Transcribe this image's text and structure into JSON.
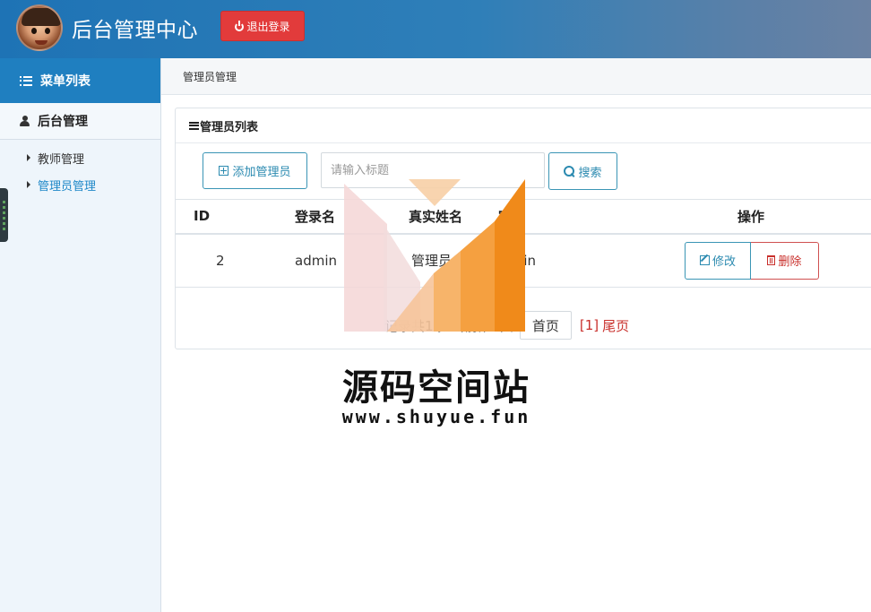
{
  "header": {
    "app_title": "后台管理中心",
    "logout_label": "退出登录",
    "colors": {
      "bar": "#1e73b5",
      "logout": "#e23b3b"
    }
  },
  "sidebar": {
    "heading": "菜单列表",
    "group_label": "后台管理",
    "items": [
      {
        "label": "教师管理",
        "active": false
      },
      {
        "label": "管理员管理",
        "active": true
      }
    ]
  },
  "main": {
    "breadcrumb": "管理员管理",
    "panel_title": "管理员列表",
    "toolbar": {
      "add_label": "添加管理员",
      "search_placeholder": "请输入标题",
      "search_label": "搜索"
    },
    "table": {
      "columns": [
        "ID",
        "登录名",
        "真实姓名",
        "密码",
        "操作"
      ],
      "rows": [
        {
          "id": "2",
          "login_name": "admin",
          "real_name": "管理员",
          "password": "admin"
        }
      ],
      "edit_label": "修改",
      "delete_label": "删除"
    },
    "pager": {
      "info": "记录共1条 当前第1页",
      "first_label": "首页",
      "current": "[1]",
      "last_label": "尾页"
    }
  },
  "watermark": {
    "title": "源码空间站",
    "url": "www.shuyue.fun"
  }
}
